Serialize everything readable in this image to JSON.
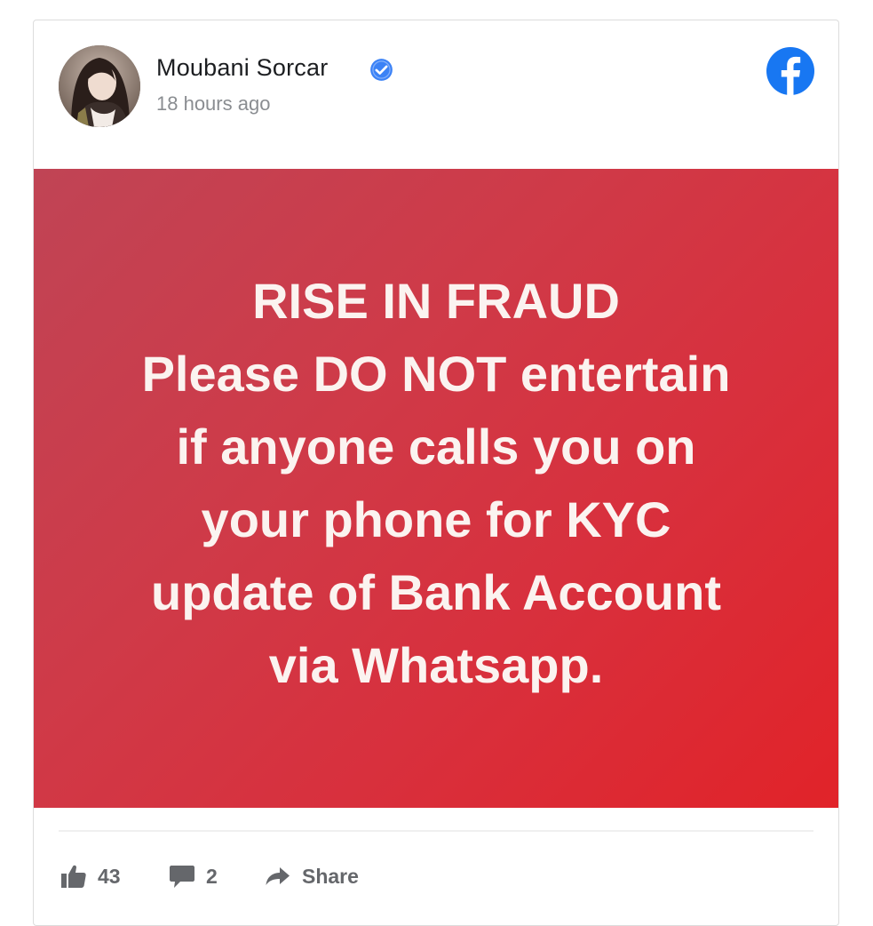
{
  "post": {
    "author": "Moubani Sorcar",
    "verified": true,
    "timestamp": "18 hours ago",
    "platform_icon": "facebook-icon",
    "image_text_lines": [
      "RISE IN FRAUD",
      "Please DO NOT entertain",
      "if anyone calls you on",
      "your phone for KYC",
      "update of Bank Account",
      "via Whatsapp."
    ],
    "image_colors": {
      "gradient_start": "#c04455",
      "gradient_end": "#e12329",
      "text": "#fbf3f0"
    }
  },
  "actions": {
    "like_count": "43",
    "comment_count": "2",
    "share_label": "Share"
  },
  "colors": {
    "facebook_blue": "#1877f2",
    "verified_blue": "#3b82f6",
    "muted": "#65676b"
  }
}
